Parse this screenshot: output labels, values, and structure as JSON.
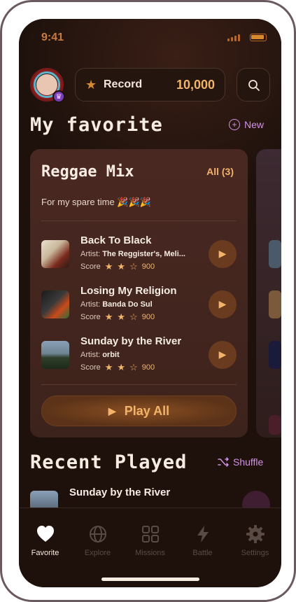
{
  "status": {
    "time": "9:41"
  },
  "header": {
    "record_label": "Record",
    "record_value": "10,000"
  },
  "favorites": {
    "title": "My favorite",
    "new_label": "New"
  },
  "playlist": {
    "title": "Reggae Mix",
    "all_label": "All (3)",
    "subtitle": "For my spare time 🎉🎉🎉",
    "artist_prefix": "Artist:",
    "score_prefix": "Score",
    "tracks": [
      {
        "name": "Back To Black",
        "artist": "The Reggister's, Meli...",
        "score": "900"
      },
      {
        "name": "Losing My Religion",
        "artist": "Banda Do Sul",
        "score": "900"
      },
      {
        "name": "Sunday by the River",
        "artist": "orbit",
        "score": "900"
      }
    ],
    "play_all_label": "Play All"
  },
  "recent": {
    "title": "Recent Played",
    "shuffle_label": "Shuffle",
    "items": [
      {
        "name": "Sunday by the River"
      }
    ]
  },
  "tabs": [
    {
      "label": "Favorite",
      "icon": "heart-icon",
      "active": true
    },
    {
      "label": "Explore",
      "icon": "globe-icon",
      "active": false
    },
    {
      "label": "Missions",
      "icon": "grid-icon",
      "active": false
    },
    {
      "label": "Battle",
      "icon": "lightning-icon",
      "active": false
    },
    {
      "label": "Settings",
      "icon": "gear-icon",
      "active": false
    }
  ],
  "colors": {
    "background": "#1e110c",
    "accent": "#f1b46a",
    "link": "#d292e6",
    "card": "#4a2822"
  }
}
